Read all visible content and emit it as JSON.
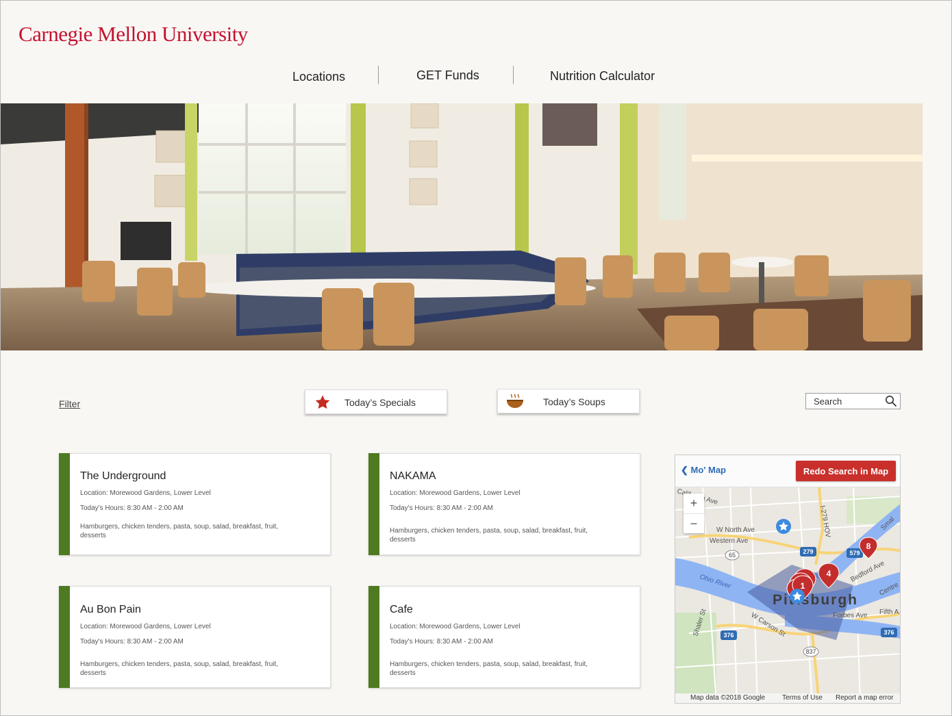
{
  "brand": {
    "logo_text": "Carnegie Mellon University",
    "color": "#c4122f"
  },
  "nav": [
    {
      "label": "Locations"
    },
    {
      "label": "GET Funds"
    },
    {
      "label": "Nutrition Calculator"
    }
  ],
  "toolbar": {
    "filter_label": "Filter",
    "specials_label": "Today’s Specials",
    "soups_label": "Today’s Soups",
    "search_placeholder": "Search"
  },
  "accent_color": "#4e7a21",
  "locations": [
    {
      "name": "The Underground",
      "location": "Location: Morewood Gardens, Lower Level",
      "hours": "Today's Hours: 8:30 AM - 2:00 AM",
      "menu": "Hamburgers, chicken tenders, pasta, soup, salad, breakfast, fruit, desserts"
    },
    {
      "name": "NAKAMA",
      "location": "Location: Morewood Gardens, Lower Level",
      "hours": "Today's Hours: 8:30 AM - 2:00 AM",
      "menu": "Hamburgers, chicken tenders, pasta, soup, salad, breakfast, fruit, desserts"
    },
    {
      "name": "Au Bon Pain",
      "location": "Location: Morewood Gardens, Lower Level",
      "hours": "Today's Hours: 8:30 AM - 2:00 AM",
      "menu": "Hamburgers, chicken tenders, pasta, soup, salad, breakfast, fruit, desserts"
    },
    {
      "name": "Cafe",
      "location": "Location: Morewood Gardens, Lower Level",
      "hours": "Today's Hours: 8:30 AM - 2:00 AM",
      "menu": "Hamburgers, chicken tenders, pasta, soup, salad, breakfast, fruit, desserts"
    }
  ],
  "map": {
    "back_label": "Mo' Map",
    "redo_label": "Redo Search in Map",
    "zoom_in": "+",
    "zoom_out": "−",
    "city_label": "Pittsburgh",
    "labels": {
      "river": "Ohio River",
      "street_1": "W North Ave",
      "street_2": "Western Ave",
      "street_3": "W Carson St",
      "street_4": "Forbes Ave",
      "street_5": "Bedford Ave",
      "street_6": "Fifth A",
      "street_7": "Shaler St",
      "street_8": "I-279 HOV",
      "street_9": "California Ave",
      "street_10": "Centre",
      "street_11": "Smal"
    },
    "shields": [
      "279",
      "579",
      "65",
      "376",
      "376",
      "837"
    ],
    "markers": [
      {
        "type": "pin",
        "label": "1"
      },
      {
        "type": "pin",
        "label": ""
      },
      {
        "type": "pin",
        "label": ""
      },
      {
        "type": "pin",
        "label": "4"
      },
      {
        "type": "pin",
        "label": "8"
      },
      {
        "type": "star",
        "label": ""
      },
      {
        "type": "star",
        "label": ""
      }
    ],
    "attribution": {
      "data": "Map data ©2018 Google",
      "terms": "Terms of Use",
      "report": "Report a map error"
    }
  }
}
